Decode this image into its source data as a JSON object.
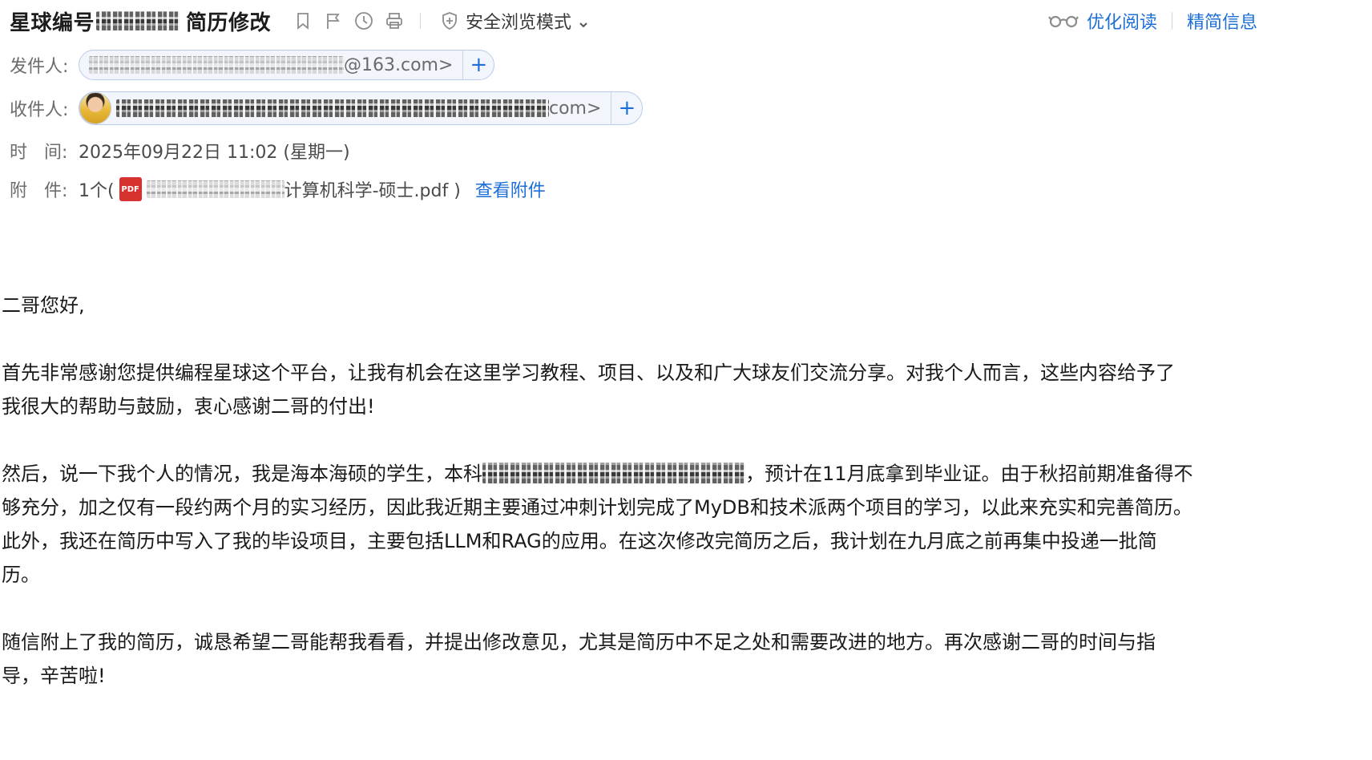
{
  "header": {
    "subject_prefix": "星球编号",
    "subject_suffix": "简历修改",
    "safe_mode_label": "安全浏览模式",
    "read_optimize_label": "优化阅读",
    "simple_info_label": "精简信息"
  },
  "meta": {
    "from_label": "发件人:",
    "from_visible": "@163.com>",
    "to_label": "收件人:",
    "to_visible": "com>",
    "time_label": "时   间:",
    "time_value": "2025年09月22日 11:02 (星期一)",
    "attach_label": "附   件:",
    "attach_count": "1个(",
    "attach_pdf_badge": "PDF",
    "attach_name_visible": "计算机科学-硕士.pdf )",
    "attach_view_link": "查看附件",
    "add_icon_glyph": "+"
  },
  "body": {
    "greeting": "二哥您好,",
    "p1_line1": "首先非常感谢您提供编程星球这个平台，让我有机会在这里学习教程、项目、以及和广大球友们交流分享。对我个人而言，这些内容给予了",
    "p1_line2": "我很大的帮助与鼓励，衷心感谢二哥的付出!",
    "p2_line1_a": "然后，说一下我个人的情况，我是海本海硕的学生，本科",
    "p2_line1_b": "，预计在11月底拿到毕业证。由于秋招前期准备得不",
    "p2_line2": "够充分，加之仅有一段约两个月的实习经历，因此我近期主要通过冲刺计划完成了MyDB和技术派两个项目的学习，以此来充实和完善简历。",
    "p2_line3": "此外，我还在简历中写入了我的毕设项目，主要包括LLM和RAG的应用。在这次修改完简历之后，我计划在九月底之前再集中投递一批简",
    "p2_line4": "历。",
    "p3_line1": "随信附上了我的简历，诚恳希望二哥能帮我看看，并提出修改意见，尤其是简历中不足之处和需要改进的地方。再次感谢二哥的时间与指",
    "p3_line2": "导，辛苦啦!"
  },
  "colors": {
    "link_blue": "#1d6fd8",
    "pdf_red": "#d8322e"
  },
  "icons": [
    "bookmark-icon",
    "flag-icon",
    "clock-icon",
    "print-icon",
    "shield-icon",
    "chevron-down-icon",
    "glasses-icon",
    "plus-icon",
    "pdf-icon",
    "avatar"
  ]
}
